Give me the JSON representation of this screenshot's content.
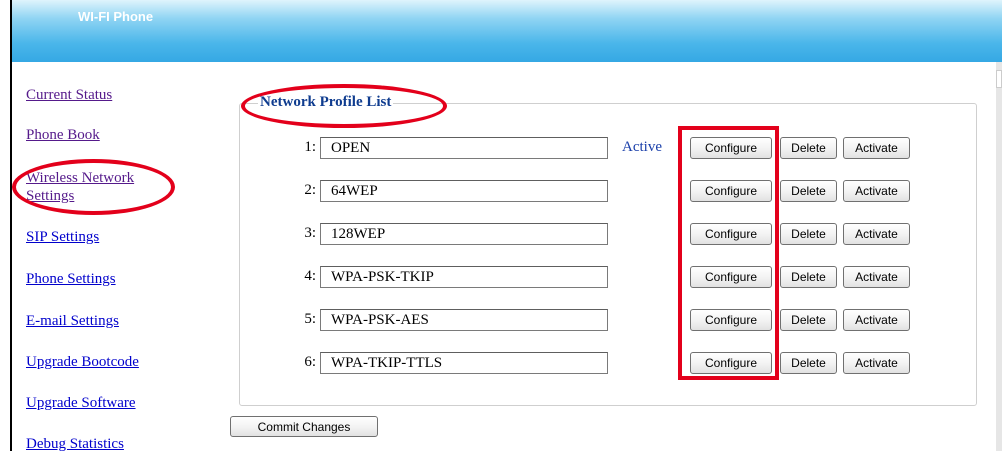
{
  "header": {
    "title": "WI-FI Phone"
  },
  "nav": [
    {
      "label": "Current Status",
      "visited": true
    },
    {
      "label": "Phone Book",
      "visited": true
    },
    {
      "label": "Wireless Network Settings",
      "line1": "Wireless Network",
      "line2": "Settings",
      "visited": true
    },
    {
      "label": "SIP Settings",
      "visited": false
    },
    {
      "label": "Phone Settings",
      "visited": false
    },
    {
      "label": "E-mail Settings",
      "visited": false
    },
    {
      "label": "Upgrade Bootcode",
      "visited": false
    },
    {
      "label": "Upgrade Software",
      "visited": false
    },
    {
      "label": "Debug Statistics",
      "visited": false
    }
  ],
  "profiles": {
    "legend": "Network Profile List",
    "rows": [
      {
        "index": "1:",
        "ssid": "OPEN",
        "status": "Active"
      },
      {
        "index": "2:",
        "ssid": "64WEP",
        "status": ""
      },
      {
        "index": "3:",
        "ssid": "128WEP",
        "status": ""
      },
      {
        "index": "4:",
        "ssid": "WPA-PSK-TKIP",
        "status": ""
      },
      {
        "index": "5:",
        "ssid": "WPA-PSK-AES",
        "status": ""
      },
      {
        "index": "6:",
        "ssid": "WPA-TKIP-TTLS",
        "status": ""
      }
    ],
    "buttons": {
      "configure": "Configure",
      "delete": "Delete",
      "activate": "Activate"
    }
  },
  "commit_label": "Commit Changes",
  "annotation_color": "#e3001b"
}
